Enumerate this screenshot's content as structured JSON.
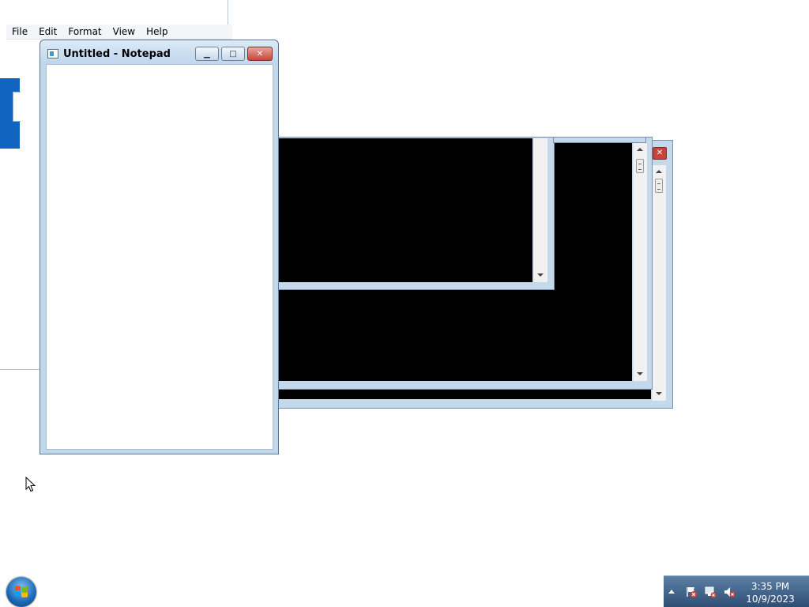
{
  "back_notepad": {
    "menu": [
      "File",
      "Edit",
      "Format",
      "View",
      "Help"
    ]
  },
  "notepad": {
    "title": "Untitled - Notepad",
    "content": "",
    "buttons": {
      "minimize": "▁",
      "maximize": "□",
      "close": "✕"
    }
  },
  "console_windows": [
    {
      "name": "console-window-front"
    },
    {
      "name": "console-window-back"
    }
  ],
  "taskbar": {
    "start_icon": "windows-start-orb",
    "tray_icons": [
      "action-center-flag-icon",
      "network-icon",
      "volume-muted-icon"
    ],
    "clock_time": "3:35 PM",
    "clock_date": "10/9/2023"
  },
  "colors": {
    "titlebar": "#c0d7ec",
    "close_red": "#c6473a",
    "taskbar": "#304e73"
  }
}
